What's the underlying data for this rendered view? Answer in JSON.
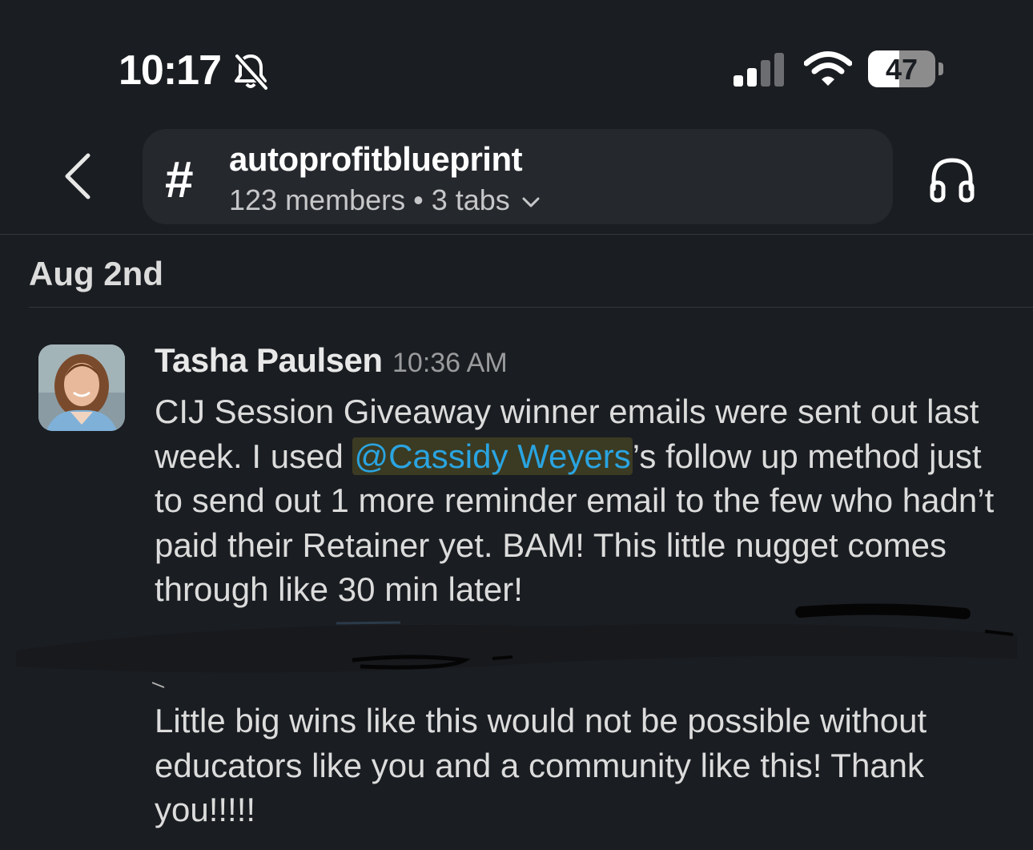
{
  "status_bar": {
    "time": "10:17",
    "battery": "47",
    "battery_level": 0.47,
    "icons": [
      "bell-slash-icon",
      "cellular-signal-icon",
      "wifi-icon",
      "battery-icon"
    ]
  },
  "header": {
    "back_icon": "chevron-left-icon",
    "channel_prefix": "#",
    "channel_name": "autoprofitblueprint",
    "meta": "123 members • 3 tabs",
    "meta_icon": "chevron-down-icon",
    "right_icon": "headphones-icon"
  },
  "date_separator": "Aug 2nd",
  "message": {
    "author": "Tasha Paulsen",
    "time": "10:36 AM",
    "body_before_mention": "CIJ Session Giveaway winner emails were sent out last week. I used ",
    "mention": "@Cassidy Weyers",
    "body_after_mention": "’s follow up method just to send out 1 more reminder email to the few who hadn’t paid their Retainer yet. BAM! This little nugget comes through like 30 min later!",
    "body_second": "Little big wins like this would not be possible without educators like you and a community like this! Thank you!!!!!"
  },
  "colors": {
    "background": "#1a1d21",
    "pill": "#25282d",
    "mention": "#2aa4e0",
    "mention_bg": "#3b3a22"
  }
}
